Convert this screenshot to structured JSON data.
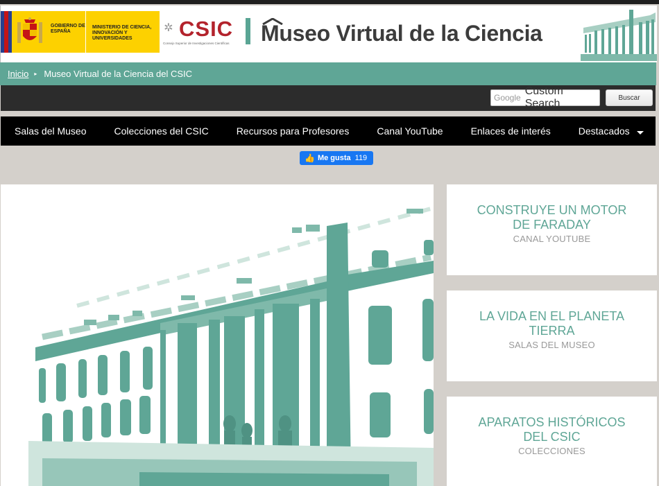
{
  "header": {
    "gov_text": "GOBIERNO DE ESPAÑA",
    "ministry_text": "MINISTERIO DE CIENCIA, INNOVACIÓN Y UNIVERSIDADES",
    "csic_word": "CSIC",
    "csic_subtitle": "Consejo Superior de Investigaciones Científicas",
    "museum_title": "Museo Virtual de la Ciencia"
  },
  "breadcrumb": {
    "home": "Inicio",
    "separator": "▸",
    "current": "Museo Virtual de la Ciencia del CSIC"
  },
  "search": {
    "google_label": "Google",
    "placeholder": "Custom Search",
    "button_label": "Buscar"
  },
  "nav": {
    "items": [
      {
        "label": "Salas del Museo"
      },
      {
        "label": "Colecciones del CSIC"
      },
      {
        "label": "Recursos para Profesores"
      },
      {
        "label": "Canal YouTube"
      },
      {
        "label": "Enlaces de interés"
      },
      {
        "label": "Destacados"
      }
    ]
  },
  "facebook": {
    "label": "Me gusta",
    "count": "119"
  },
  "cards": [
    {
      "title": "CONSTRUYE UN MOTOR DE FARADAY",
      "subtitle": "CANAL YOUTUBE"
    },
    {
      "title": "LA VIDA EN EL PLANETA TIERRA",
      "subtitle": "SALAS DEL MUSEO"
    },
    {
      "title": "APARATOS HISTÓRICOS DEL CSIC",
      "subtitle": "COLECCIONES"
    }
  ],
  "colors": {
    "accent_green": "#5fa696",
    "csic_red": "#b3232c",
    "gov_yellow": "#fdd100",
    "facebook_blue": "#1877f2"
  }
}
